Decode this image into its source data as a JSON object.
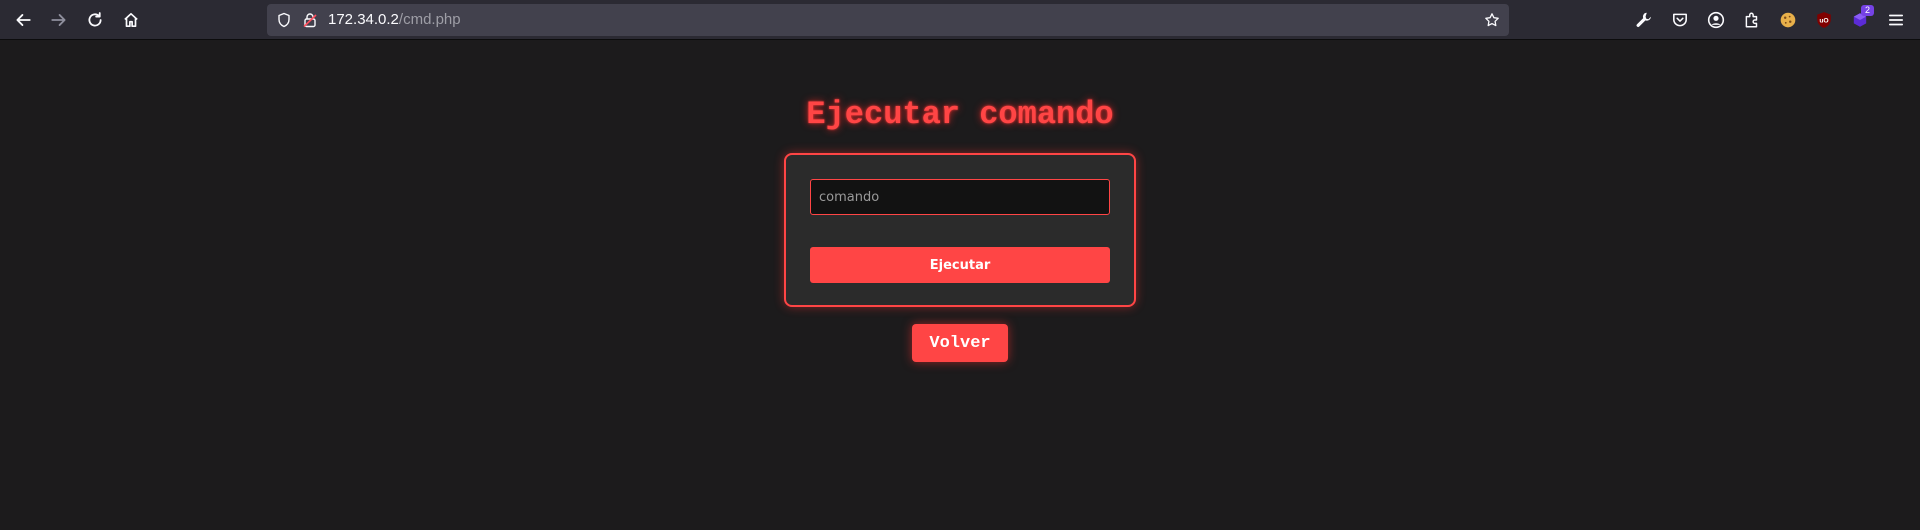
{
  "browser": {
    "url_host": "172.34.0.2",
    "url_path": "/cmd.php",
    "nav_icons": [
      "back-arrow-icon",
      "forward-arrow-icon",
      "reload-icon",
      "home-icon"
    ],
    "url_icons": [
      "shield-icon",
      "insecure-lock-icon",
      "bookmark-star-icon"
    ],
    "extensions": [
      {
        "name": "wrench-icon"
      },
      {
        "name": "pocket-icon"
      },
      {
        "name": "account-icon"
      },
      {
        "name": "extensions-puzzle-icon"
      },
      {
        "name": "cookie-extension-icon"
      },
      {
        "name": "ublock-origin-icon",
        "label": "uO"
      },
      {
        "name": "purple-extension-icon",
        "badge": "2"
      },
      {
        "name": "hamburger-menu-icon"
      }
    ]
  },
  "page": {
    "title": "Ejecutar comando",
    "form": {
      "input_placeholder": "comando",
      "input_value": "",
      "submit_label": "Ejecutar"
    },
    "back_label": "Volver"
  },
  "colors": {
    "accent": "#ff4545",
    "background": "#1c1b1c",
    "card": "#2b2b2b",
    "input_bg": "#121212",
    "toolbar": "#2b2a33",
    "urlbar": "#42414d"
  }
}
